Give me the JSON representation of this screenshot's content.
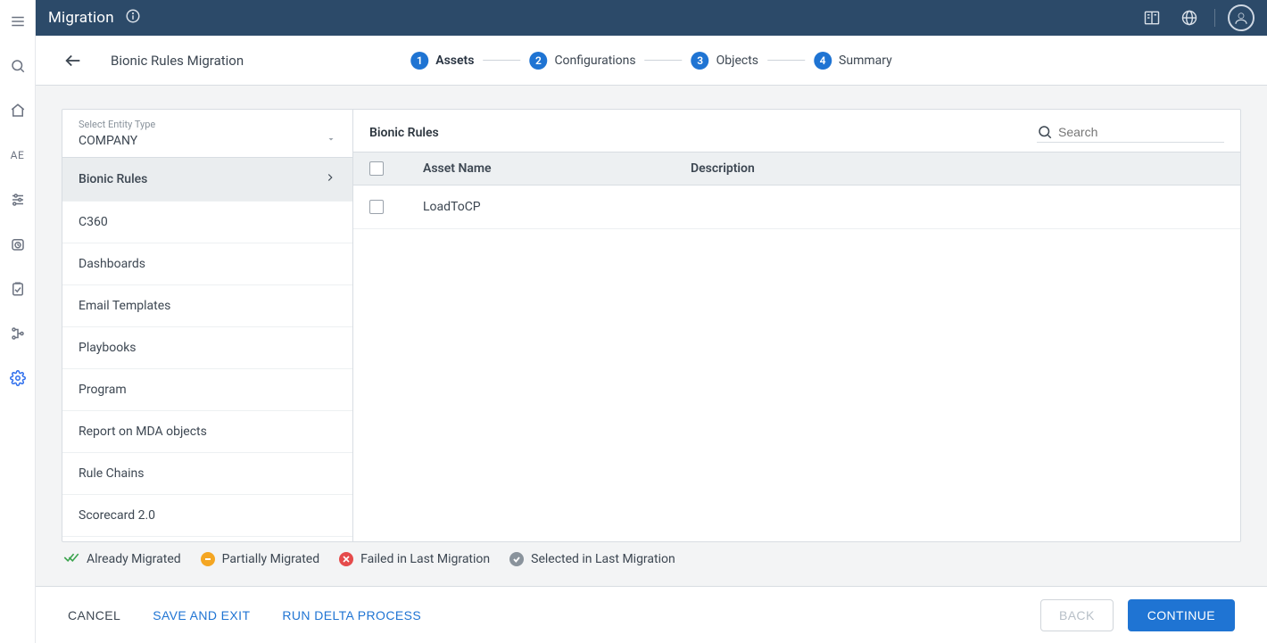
{
  "header": {
    "title": "Migration"
  },
  "rail": {
    "ae_label": "AE"
  },
  "subhead": {
    "breadcrumb": "Bionic Rules Migration"
  },
  "stepper": {
    "steps": [
      {
        "num": "1",
        "label": "Assets",
        "active": true
      },
      {
        "num": "2",
        "label": "Configurations",
        "active": false
      },
      {
        "num": "3",
        "label": "Objects",
        "active": false
      },
      {
        "num": "4",
        "label": "Summary",
        "active": false
      }
    ]
  },
  "entitySelect": {
    "label": "Select Entity Type",
    "value": "COMPANY"
  },
  "assetTypes": [
    {
      "label": "Bionic Rules",
      "selected": true
    },
    {
      "label": "C360",
      "selected": false
    },
    {
      "label": "Dashboards",
      "selected": false
    },
    {
      "label": "Email Templates",
      "selected": false
    },
    {
      "label": "Playbooks",
      "selected": false
    },
    {
      "label": "Program",
      "selected": false
    },
    {
      "label": "Report on MDA objects",
      "selected": false
    },
    {
      "label": "Rule Chains",
      "selected": false
    },
    {
      "label": "Scorecard 2.0",
      "selected": false
    }
  ],
  "assetsPanel": {
    "title": "Bionic Rules",
    "searchPlaceholder": "Search",
    "columns": {
      "name": "Asset Name",
      "desc": "Description"
    },
    "rows": [
      {
        "name": "LoadToCP",
        "desc": ""
      }
    ]
  },
  "legend": {
    "already": "Already Migrated",
    "partial": "Partially Migrated",
    "failed": "Failed in Last Migration",
    "selected": "Selected in Last Migration"
  },
  "footer": {
    "cancel": "CANCEL",
    "saveExit": "SAVE AND EXIT",
    "runDelta": "RUN DELTA PROCESS",
    "back": "BACK",
    "continue": "CONTINUE"
  }
}
